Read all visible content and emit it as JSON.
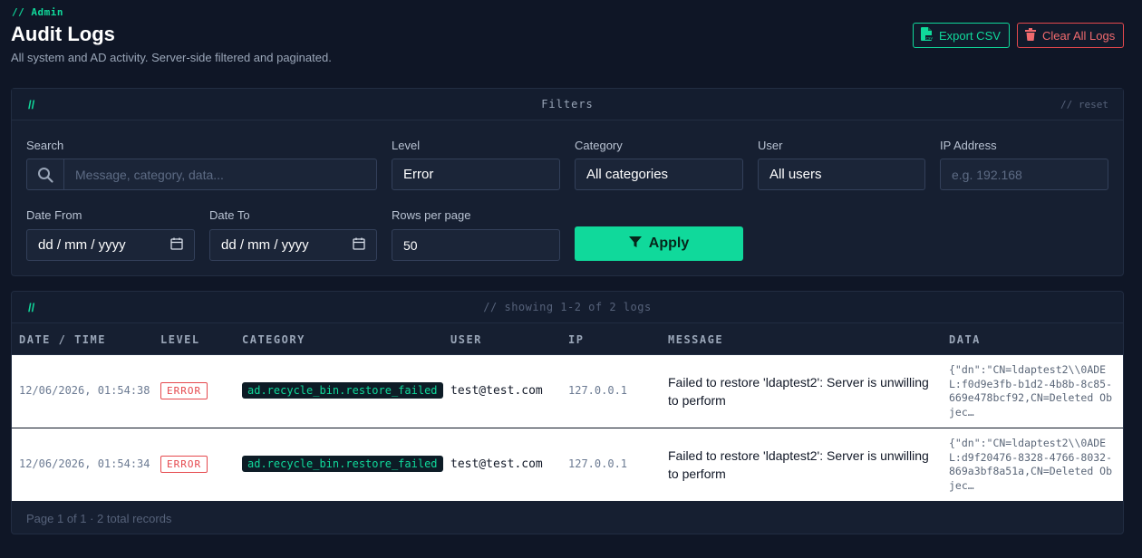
{
  "header": {
    "eyebrow": "// Admin",
    "title": "Audit Logs",
    "subtitle": "All system and AD activity. Server-side filtered and paginated.",
    "export_label": "Export CSV",
    "clear_label": "Clear All Logs"
  },
  "filters": {
    "slashes": "//",
    "title": "Filters",
    "reset": "// reset",
    "search": {
      "label": "Search",
      "placeholder": "Message, category, data..."
    },
    "level": {
      "label": "Level",
      "value": "Error"
    },
    "category": {
      "label": "Category",
      "value": "All categories"
    },
    "user": {
      "label": "User",
      "value": "All users"
    },
    "ip": {
      "label": "IP Address",
      "placeholder": "e.g. 192.168"
    },
    "date_from": {
      "label": "Date From",
      "value": "dd / mm / yyyy"
    },
    "date_to": {
      "label": "Date To",
      "value": "dd / mm / yyyy"
    },
    "rows_per_page": {
      "label": "Rows per page",
      "value": "50"
    },
    "apply_label": "Apply"
  },
  "logs": {
    "slashes": "//",
    "summary": "// showing 1-2 of 2 logs",
    "columns": [
      "DATE / TIME",
      "LEVEL",
      "CATEGORY",
      "USER",
      "IP",
      "MESSAGE",
      "DATA"
    ],
    "rows": [
      {
        "datetime": "12/06/2026, 01:54:38",
        "level": "ERROR",
        "category": "ad.recycle_bin.restore_failed",
        "user": "test@test.com",
        "ip": "127.0.0.1",
        "message": "Failed to restore 'ldaptest2': Server is unwilling to perform",
        "data": "{\"dn\":\"CN=ldaptest2\\\\0ADEL:f0d9e3fb-b1d2-4b8b-8c85-669e478bcf92,CN=Deleted Objec…"
      },
      {
        "datetime": "12/06/2026, 01:54:34",
        "level": "ERROR",
        "category": "ad.recycle_bin.restore_failed",
        "user": "test@test.com",
        "ip": "127.0.0.1",
        "message": "Failed to restore 'ldaptest2': Server is unwilling to perform",
        "data": "{\"dn\":\"CN=ldaptest2\\\\0ADEL:d9f20476-8328-4766-8032-869a3bf8a51a,CN=Deleted Objec…"
      }
    ],
    "pagination": "Page 1 of 1 · 2 total records"
  },
  "colors": {
    "accent": "#10d99b",
    "danger": "#e5484d",
    "background": "#0f1626",
    "panel": "#161f31"
  },
  "icons": {
    "export": "file-csv-icon",
    "clear": "trash-icon",
    "search": "search-icon",
    "calendar": "calendar-icon",
    "filter": "filter-icon"
  }
}
